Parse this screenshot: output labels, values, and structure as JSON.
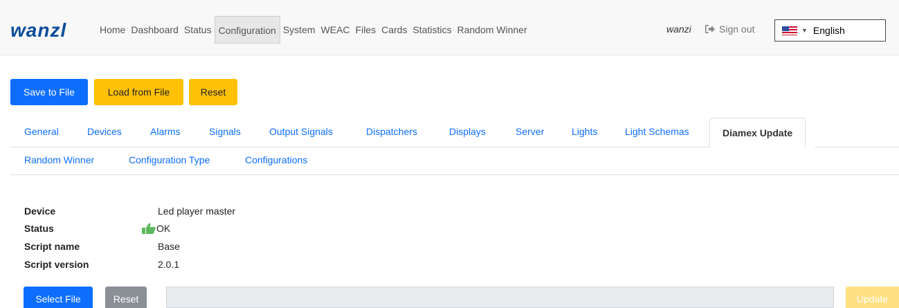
{
  "navbar": {
    "logo": "wanzl",
    "links": [
      "Home",
      "Dashboard",
      "Status",
      "Configuration",
      "System",
      "WEAC",
      "Files",
      "Cards",
      "Statistics",
      "Random Winner"
    ],
    "active_link": "Configuration",
    "user": "wanzi",
    "signout": "Sign out",
    "language": "English",
    "language_flag": "us-flag-icon"
  },
  "actions": {
    "save": "Save to File",
    "load": "Load from File",
    "reset": "Reset"
  },
  "tabs": {
    "row1": [
      "General",
      "Devices",
      "Alarms",
      "Signals",
      "Output Signals",
      "Dispatchers",
      "Displays",
      "Server",
      "Lights",
      "Light Schemas",
      "Diamex Update"
    ],
    "row2": [
      "Random Winner",
      "Configuration Type",
      "Configurations"
    ],
    "active": "Diamex Update"
  },
  "details": {
    "device_label": "Device",
    "device_value": "Led player master",
    "status_label": "Status",
    "status_value": "OK",
    "status_icon": "thumbs-up-icon",
    "script_name_label": "Script name",
    "script_name_value": "Base",
    "script_version_label": "Script version",
    "script_version_value": "2.0.1"
  },
  "file_actions": {
    "select": "Select File",
    "reset": "Reset",
    "update": "Update"
  },
  "colors": {
    "primary": "#0d6efd",
    "warning": "#ffc107",
    "secondary": "#8a8f96",
    "logo": "#0a4d9a",
    "ok_green": "#5cb85c"
  }
}
